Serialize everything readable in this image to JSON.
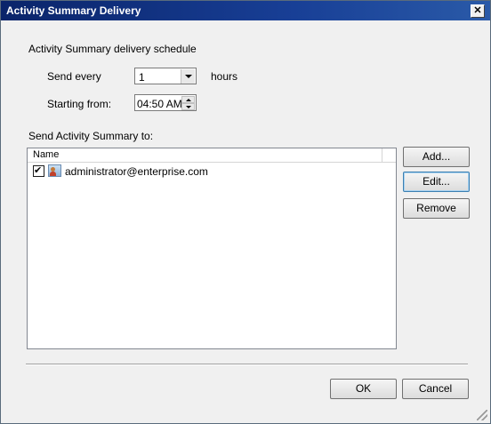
{
  "window": {
    "title": "Activity Summary Delivery"
  },
  "schedule": {
    "heading": "Activity Summary delivery schedule",
    "send_every_label": "Send every",
    "send_every_value": "1",
    "hours_label": "hours",
    "starting_from_label": "Starting from:",
    "starting_from_value": "04:50 AM"
  },
  "recipients": {
    "heading": "Send Activity Summary to:",
    "columns": [
      "Name"
    ],
    "rows": [
      {
        "checked": true,
        "name": "administrator@enterprise.com"
      }
    ]
  },
  "buttons": {
    "add": "Add...",
    "edit": "Edit...",
    "remove": "Remove",
    "ok": "OK",
    "cancel": "Cancel"
  },
  "icons": {
    "close": "close-icon",
    "dropdown": "chevron-down-icon",
    "spin_up": "spin-up-icon",
    "spin_down": "spin-down-icon",
    "user": "user-icon",
    "resize": "resize-grip-icon"
  }
}
